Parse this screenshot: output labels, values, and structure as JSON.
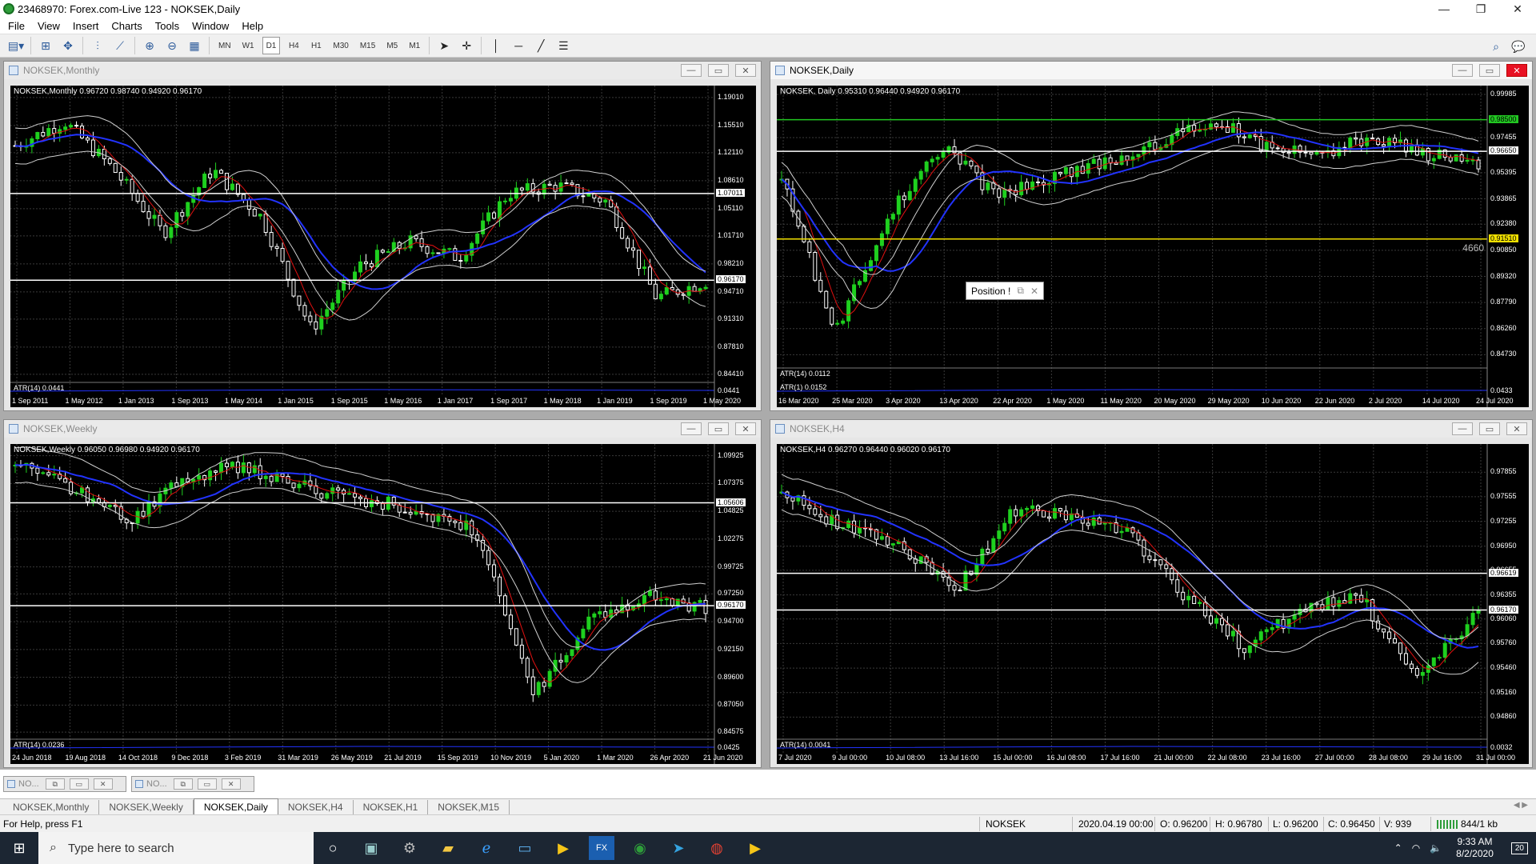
{
  "window": {
    "title": "23468970: Forex.com-Live 123 - NOKSEK,Daily",
    "controls": [
      "—",
      "❐",
      "✕"
    ]
  },
  "menu": [
    "File",
    "View",
    "Insert",
    "Charts",
    "Tools",
    "Window",
    "Help"
  ],
  "toolbar": {
    "timeframes": [
      "MN",
      "W1",
      "D1",
      "H4",
      "H1",
      "M30",
      "M15",
      "M5",
      "M1"
    ]
  },
  "charts": [
    {
      "id": "monthly",
      "title": "NOKSEK,Monthly",
      "header": "NOKSEK,Monthly  0.96720 0.98740 0.94920 0.96170",
      "atr": "ATR(14) 0.0441",
      "atr_value": "0.0441",
      "y_ticks": [
        "1.19010",
        "1.15510",
        "1.12110",
        "1.08610",
        "1.05110",
        "1.01710",
        "0.98210",
        "0.94710",
        "0.91310",
        "0.87810",
        "0.84410"
      ],
      "y_range": [
        0.835,
        1.205
      ],
      "price_tags": [
        {
          "value": "1.07011",
          "y": 1.07011,
          "bg": "#ffffff"
        },
        {
          "value": "0.96170",
          "y": 0.9617,
          "bg": "#ffffff"
        }
      ],
      "x_ticks": [
        "1 Sep 2011",
        "1 May 2012",
        "1 Jan 2013",
        "1 Sep 2013",
        "1 May 2014",
        "1 Jan 2015",
        "1 Sep 2015",
        "1 May 2016",
        "1 Jan 2017",
        "1 Sep 2017",
        "1 May 2018",
        "1 Jan 2019",
        "1 Sep 2019",
        "1 May 2020"
      ]
    },
    {
      "id": "daily",
      "title": "NOKSEK,Daily",
      "header": "NOKSEK, Daily  0.95310 0.96440 0.94920 0.96170",
      "atr": "ATR(14) 0.0112",
      "atr2": "ATR(1) 0.0152",
      "atr_value": "0.0433",
      "y_ticks": [
        "0.99985",
        "0.97455",
        "0.95395",
        "0.93865",
        "0.92380",
        "0.90850",
        "0.89320",
        "0.87790",
        "0.86260",
        "0.84730"
      ],
      "y_range": [
        0.84,
        1.005
      ],
      "price_tags": [
        {
          "value": "0.98500",
          "y": 0.985,
          "bg": "#22c722"
        },
        {
          "value": "0.96650",
          "y": 0.9665,
          "bg": "#ffffff"
        },
        {
          "value": "0.91510",
          "y": 0.9151,
          "bg": "#f0e000"
        }
      ],
      "side_label": "4660",
      "position_box": "Position !",
      "x_ticks": [
        "16 Mar 2020",
        "25 Mar 2020",
        "3 Apr 2020",
        "13 Apr 2020",
        "22 Apr 2020",
        "1 May 2020",
        "11 May 2020",
        "20 May 2020",
        "29 May 2020",
        "10 Jun 2020",
        "22 Jun 2020",
        "2 Jul 2020",
        "14 Jul 2020",
        "24 Jul 2020"
      ]
    },
    {
      "id": "weekly",
      "title": "NOKSEK,Weekly",
      "header": "NOKSEK,Weekly  0.96050 0.96980 0.94920 0.96170",
      "atr": "ATR(14) 0.0236",
      "atr_value": "0.0425",
      "y_ticks": [
        "1.09925",
        "1.07375",
        "1.04825",
        "1.02275",
        "0.99725",
        "0.97250",
        "0.94700",
        "0.92150",
        "0.89600",
        "0.87050",
        "0.84575"
      ],
      "y_range": [
        0.84,
        1.11
      ],
      "price_tags": [
        {
          "value": "1.05606",
          "y": 1.05606,
          "bg": "#ffffff"
        },
        {
          "value": "0.96170",
          "y": 0.9617,
          "bg": "#ffffff"
        }
      ],
      "x_ticks": [
        "24 Jun 2018",
        "19 Aug 2018",
        "14 Oct 2018",
        "9 Dec 2018",
        "3 Feb 2019",
        "31 Mar 2019",
        "26 May 2019",
        "21 Jul 2019",
        "15 Sep 2019",
        "10 Nov 2019",
        "5 Jan 2020",
        "1 Mar 2020",
        "26 Apr 2020",
        "21 Jun 2020"
      ]
    },
    {
      "id": "h4",
      "title": "NOKSEK,H4",
      "header": "NOKSEK,H4  0.96270 0.96440 0.96020 0.96170",
      "atr": "ATR(14) 0.0041",
      "atr_value": "0.0032",
      "y_ticks": [
        "0.97855",
        "0.97555",
        "0.97255",
        "0.96950",
        "0.96655",
        "0.96355",
        "0.96060",
        "0.95760",
        "0.95460",
        "0.95160",
        "0.94860"
      ],
      "y_range": [
        0.946,
        0.982
      ],
      "price_tags": [
        {
          "value": "0.96619",
          "y": 0.96619,
          "bg": "#ffffff"
        },
        {
          "value": "0.96170",
          "y": 0.9617,
          "bg": "#ffffff"
        }
      ],
      "x_ticks": [
        "7 Jul 2020",
        "9 Jul 00:00",
        "10 Jul 08:00",
        "13 Jul 16:00",
        "15 Jul 00:00",
        "16 Jul 08:00",
        "17 Jul 16:00",
        "21 Jul 00:00",
        "22 Jul 08:00",
        "23 Jul 16:00",
        "27 Jul 00:00",
        "28 Jul 08:00",
        "29 Jul 16:00",
        "31 Jul 00:00"
      ]
    }
  ],
  "minimized": [
    {
      "label": "NO..."
    },
    {
      "label": "NO..."
    }
  ],
  "tabs": [
    "NOKSEK,Monthly",
    "NOKSEK,Weekly",
    "NOKSEK,Daily",
    "NOKSEK,H4",
    "NOKSEK,H1",
    "NOKSEK,M15"
  ],
  "active_tab": "NOKSEK,Daily",
  "status": {
    "help": "For Help, press F1",
    "symbol": "NOKSEK",
    "datetime": "2020.04.19 00:00",
    "open": "O: 0.96200",
    "high": "H: 0.96780",
    "low": "L: 0.96200",
    "close": "C: 0.96450",
    "volume": "V: 939",
    "traffic": "844/1 kb"
  },
  "taskbar": {
    "search_placeholder": "Type here to search",
    "time": "9:33 AM",
    "date": "8/2/2020",
    "notifications": "20"
  },
  "colors": {
    "bull_candle": "#1fd01f",
    "bear_candle": "#ffffff",
    "grid": "#3a3a3a",
    "ma_blue": "#2233ff",
    "ma_red": "#e01010",
    "band_gray": "#cfcfcf",
    "hline": "#ffffff"
  }
}
